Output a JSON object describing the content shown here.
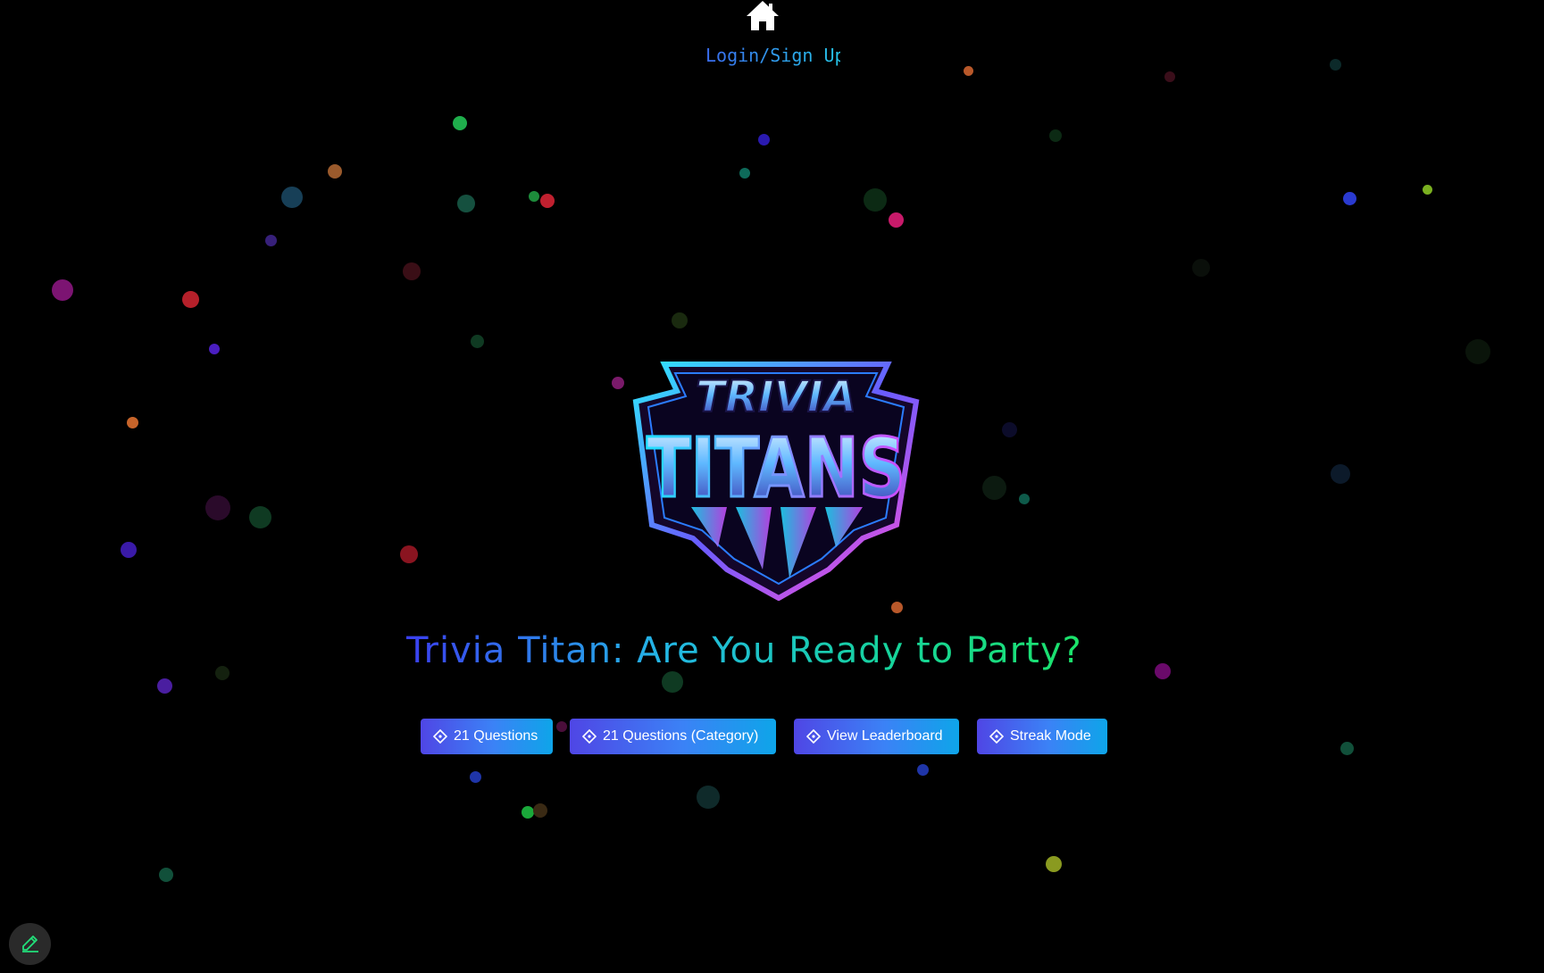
{
  "nav": {
    "home_icon": "home-icon",
    "login_label": "Login/Sign Up"
  },
  "logo": {
    "line1": "TRIVIA",
    "line2": "TITANS"
  },
  "headline": "Trivia Titan: Are You Ready to Party?",
  "buttons": [
    {
      "label": "21 Questions",
      "icon": "diamond-icon"
    },
    {
      "label": "21 Questions (Category)",
      "icon": "diamond-icon"
    },
    {
      "label": "View Leaderboard",
      "icon": "diamond-icon"
    },
    {
      "label": "Streak Mode",
      "icon": "diamond-icon"
    }
  ],
  "edit_button": {
    "icon": "pencil-icon"
  },
  "colors": {
    "background": "#000000",
    "accent_blue": "#3b82f6",
    "accent_indigo": "#4f46e5",
    "accent_green": "#1de85a",
    "accent_cyan": "#26c5e8",
    "accent_pink": "#e040fb"
  }
}
